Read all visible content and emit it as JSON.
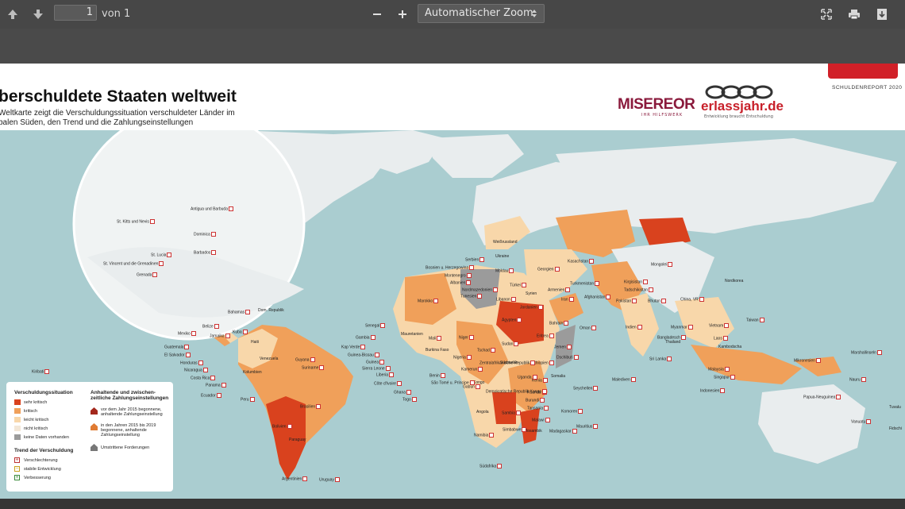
{
  "toolbar": {
    "page_current": "1",
    "page_total_label": "von 1",
    "zoom_label": "Automatischer Zoom"
  },
  "document": {
    "title": "berschuldete Staaten weltweit",
    "subtitle_line1": "Weltkarte zeigt die Verschuldungssituation verschuldeter Länder im",
    "subtitle_line2": "balen Süden, den Trend und die Zahlungseinstellungen",
    "report_label": "SCHULDENREPORT 2020",
    "logo_misereor": "MISEREOR",
    "logo_misereor_sub": "IHR HILFSWERK",
    "logo_erlass": "erlassjahr.de",
    "logo_erlass_sub": "Entwicklung braucht Entschuldung"
  },
  "colors": {
    "ocean": "#aacdd0",
    "sehr_kritisch": "#d9421e",
    "kritisch": "#f0a05a",
    "leicht_kritisch": "#f8d7aa",
    "nicht_kritisch": "#f3e7d7",
    "keine_daten": "#9b9b9b",
    "other_land": "#e9edee"
  },
  "legend": {
    "heading_situation": "Verschuldungssituation",
    "situation_items": [
      "sehr kritisch",
      "kritisch",
      "leicht kritisch",
      "nicht kritisch",
      "keine Daten vorhanden"
    ],
    "heading_trend": "Trend der Verschuldung",
    "trend_items": [
      "Verschlechterung",
      "stabile Entwicklung",
      "Verbesserung"
    ],
    "heading_payments_1": "Anhaltende und zwischen-",
    "heading_payments_2": "zeitliche Zahlungseinstellungen",
    "payment_item_1a": "vor dem Jahr 2015 begonnene,",
    "payment_item_1b": "anhaltende Zahlungseinstellung",
    "payment_item_2a": "in den Jahren 2015 bis 2019",
    "payment_item_2b": "begonnene, anhaltende",
    "payment_item_2c": "Zahlungseinstellung",
    "payment_item_3": "Umstrittene Forderungen"
  },
  "inset_labels": [
    "St. Kitts und Nevis",
    "Antigua und Barbuda",
    "Dominica",
    "St. Lucia",
    "Barbados",
    "St. Vincent und die Grenadinen",
    "Grenada"
  ],
  "country_labels": [
    "Bahamas",
    "Dom. Republik",
    "Belize",
    "Kuba",
    "Mexiko",
    "Jamaika",
    "Haiti",
    "Guatemala",
    "El Salvador",
    "Honduras",
    "Nicaragua",
    "Costa Rica",
    "Panama",
    "Ecuador",
    "Peru",
    "Kolumbien",
    "Venezuela",
    "Guyana",
    "Suriname",
    "Brasilien",
    "Bolivien",
    "Paraguay",
    "Argentinien",
    "Uruguay",
    "Kiribati",
    "Weißrussland",
    "Ukraine",
    "Moldau",
    "Serbien",
    "Bosnien u. Herzegowina",
    "Montenegro",
    "Albanien",
    "Nordmazedonien",
    "Georgien",
    "Armenien",
    "Türkei",
    "Syrien",
    "Libanon",
    "Jordanien",
    "Ägypten",
    "Kasachstan",
    "Turkmenistan",
    "Kirgisistan",
    "Tadschikistan",
    "Mongolei",
    "Afghanistan",
    "Pakistan",
    "Bhutan",
    "China, VR",
    "Nordkorea",
    "Iran",
    "Bahrain",
    "Oman",
    "Jemen",
    "Indien",
    "Bangladesch",
    "Myanmar",
    "Laos",
    "Vietnam",
    "Kambodscha",
    "Thailand",
    "Sri Lanka",
    "Malaysia",
    "Singapur",
    "Indonesien",
    "Malediven",
    "Taiwan",
    "Marokko",
    "Tunesien",
    "Senegal",
    "Gambia",
    "Kap Verde",
    "Guinea-Bissau",
    "Guinea",
    "Sierra Leone",
    "Liberia",
    "Côte d'Ivoire",
    "Ghana",
    "Togo",
    "Mauretanien",
    "Mali",
    "Burkina Faso",
    "Niger",
    "Nigeria",
    "Benin",
    "Tschad",
    "Sudan",
    "Eritrea",
    "Dschibuti",
    "Äthiopien",
    "Somalia",
    "Kenia",
    "Uganda",
    "Ruanda",
    "Burundi",
    "Tansania",
    "Kamerun",
    "Gabun",
    "Kongo",
    "São Tomé u. Príncipe",
    "Zentralafrikanische Republik",
    "Südsudan",
    "Demokratische Republik Kongo",
    "Angola",
    "Sambia",
    "Malawi",
    "Mosambik",
    "Simbabwe",
    "Namibia",
    "Südafrika",
    "Madagaskar",
    "Komoren",
    "Seychellen",
    "Mauritius",
    "Mikronesien",
    "Marshallinseln",
    "Nauru",
    "Papua-Neuguinea",
    "Vanuatu",
    "Tuvalu",
    "Fidschi"
  ]
}
